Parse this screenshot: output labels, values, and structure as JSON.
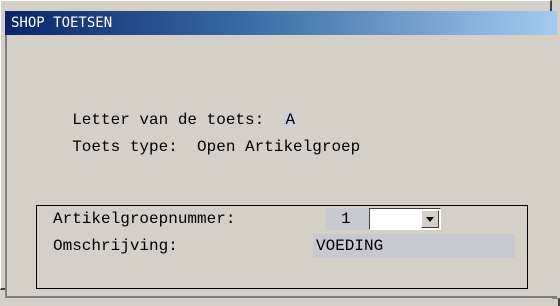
{
  "window": {
    "title": "SHOP TOETSEN"
  },
  "toets": {
    "letter_label": "Letter van de toets:",
    "letter_value": "A",
    "type_label": "Toets type:",
    "type_value": "Open Artikelgroep"
  },
  "artikelgroep": {
    "nummer_label": "Artikelgroepnummer:",
    "nummer_value": "1",
    "omschrijving_label": "Omschrijving:",
    "omschrijving_value": "VOEDING"
  },
  "colors": {
    "titlebar_start": "#0a246a",
    "titlebar_end": "#a6caf0",
    "window_bg": "#d4d0c8"
  },
  "icons": {
    "dropdown": "chevron-down-icon"
  }
}
